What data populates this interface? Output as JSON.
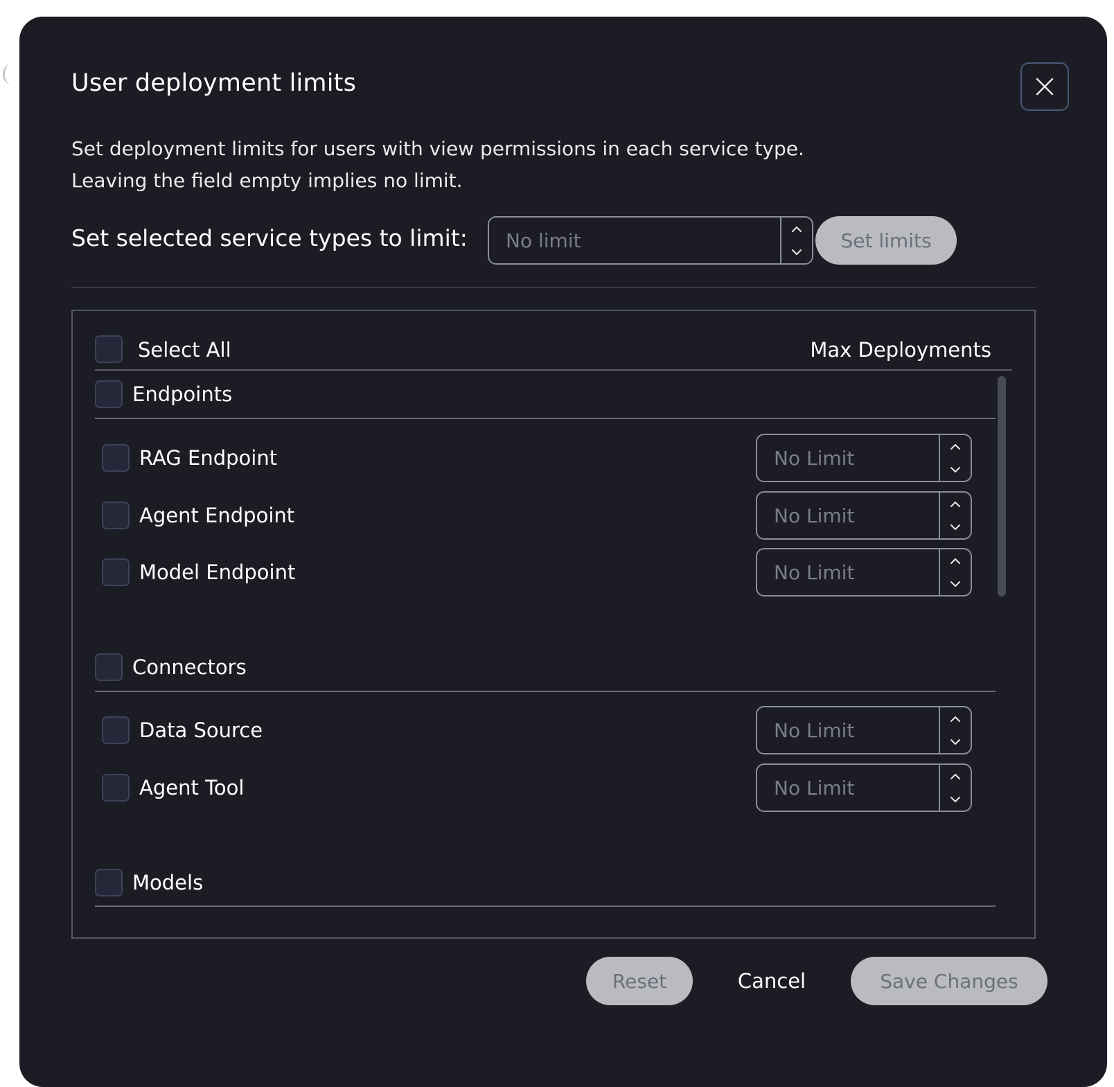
{
  "dialog": {
    "title": "User deployment limits",
    "description_line1": "Set deployment limits for users with view permissions in each service type.",
    "description_line2": "Leaving the field empty implies no limit."
  },
  "bulk": {
    "label": "Set selected service types to limit:",
    "placeholder": "No limit",
    "button_label": "Set limits"
  },
  "list": {
    "select_all_label": "Select All",
    "column_header": "Max Deployments",
    "groups": [
      {
        "title": "Endpoints",
        "items": [
          {
            "label": "RAG Endpoint",
            "placeholder": "No Limit"
          },
          {
            "label": "Agent Endpoint",
            "placeholder": "No Limit"
          },
          {
            "label": "Model Endpoint",
            "placeholder": "No Limit"
          }
        ]
      },
      {
        "title": "Connectors",
        "items": [
          {
            "label": "Data Source",
            "placeholder": "No Limit"
          },
          {
            "label": "Agent Tool",
            "placeholder": "No Limit"
          }
        ]
      },
      {
        "title": "Models",
        "items": []
      }
    ]
  },
  "footer": {
    "reset_label": "Reset",
    "cancel_label": "Cancel",
    "save_label": "Save Changes"
  },
  "icons": {
    "close": "close-icon",
    "up": "chevron-up-icon",
    "down": "chevron-down-icon"
  },
  "colors": {
    "modal_bg": "#1b1c24",
    "disabled_button_bg": "#b9bbc1",
    "disabled_button_text": "#6d7079",
    "checkbox_bg": "#252838"
  }
}
